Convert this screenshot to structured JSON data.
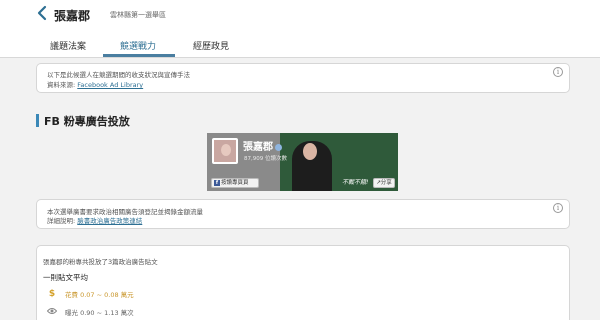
{
  "header": {
    "back_icon": "chevron-left-icon",
    "name": "張嘉郡",
    "district": "雲林縣第一選舉區"
  },
  "tabs": [
    {
      "label": "議題法案",
      "active": false
    },
    {
      "label": "競選戰力",
      "active": true
    },
    {
      "label": "經歷政見",
      "active": false
    }
  ],
  "intro": {
    "line1": "以下是此候選人在競選期間的收支狀況與宣傳手法",
    "source_prefix": "資料來源: ",
    "source_link": "Facebook Ad Library",
    "info_icon": "info-icon"
  },
  "section": {
    "title": "FB 粉專廣告投放"
  },
  "fb_banner": {
    "page_name": "張嘉郡",
    "subtitle": "87,909 位讚次數",
    "follow_button": "按讚專頁頁",
    "share_button": "↗分享",
    "slogan": "不戰不餓!"
  },
  "disclosure": {
    "line1": "本次選舉廣書要求政治相關廣告須登記並揭錄金額流量",
    "detail_prefix": "詳細說明: ",
    "detail_link": "臉書政治廣告政策連結",
    "info_icon": "info-icon"
  },
  "stats": {
    "summary": "張嘉郡的粉專共投放了3篇政治廣告貼文",
    "heading": "一則貼文平均",
    "spend_label": "花費 0.07 ~ 0.08 萬元",
    "views_label": "曝光 0.90 ~ 1.13 萬次",
    "accent_color": "#c9962b"
  },
  "colors": {
    "brand": "#2d6f93",
    "section_bar": "#3b88b7"
  }
}
